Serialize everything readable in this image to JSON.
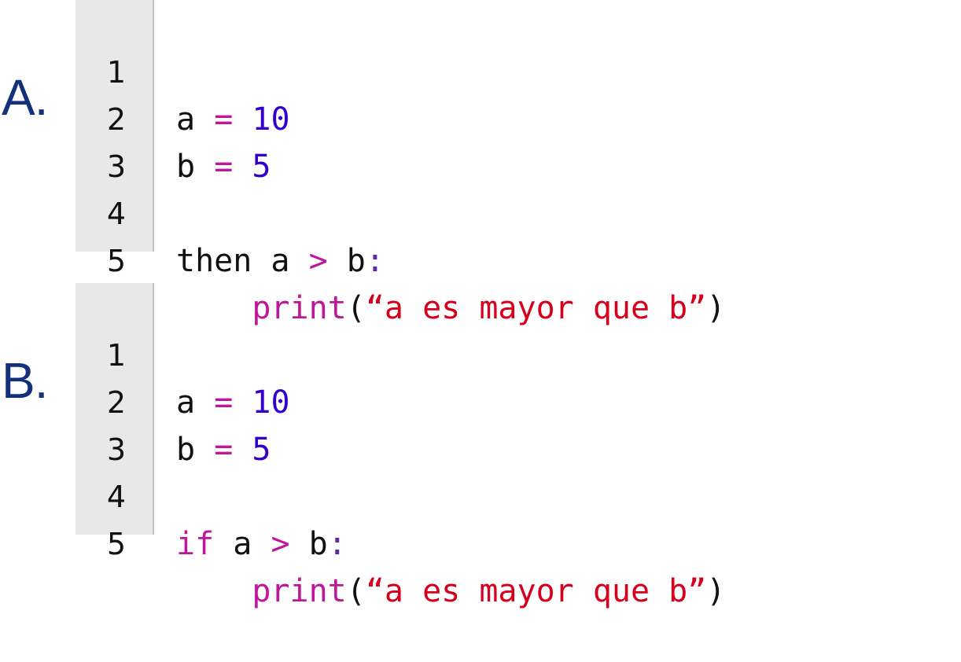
{
  "options": [
    {
      "letter": "A.",
      "lines": [
        {
          "number": "1",
          "var": "a",
          "op": "=",
          "value": "10"
        },
        {
          "number": "2",
          "var": "b",
          "op": "=",
          "value": "5"
        },
        {
          "number": "3"
        },
        {
          "number": "4",
          "keyword": "then",
          "left": "a",
          "comparator": ">",
          "right": "b",
          "colon": ":"
        },
        {
          "number": "5",
          "indent": "    ",
          "fn": "print",
          "open": "(",
          "string": "“a es mayor que b”",
          "close": ")"
        }
      ]
    },
    {
      "letter": "B.",
      "lines": [
        {
          "number": "1",
          "var": "a",
          "op": "=",
          "value": "10"
        },
        {
          "number": "2",
          "var": "b",
          "op": "=",
          "value": "5"
        },
        {
          "number": "3"
        },
        {
          "number": "4",
          "keyword": "if",
          "left": "a",
          "comparator": ">",
          "right": "b",
          "colon": ":"
        },
        {
          "number": "5",
          "indent": "    ",
          "fn": "print",
          "open": "(",
          "string": "“a es mayor que b”",
          "close": ")"
        }
      ]
    }
  ],
  "colors": {
    "letter": "#13307a",
    "operator": "#c0179a",
    "number": "#3300cc",
    "keyword_if": "#c0179a",
    "function": "#c0179a",
    "string": "#d6001c",
    "gutter_background": "#e8e8e8"
  }
}
